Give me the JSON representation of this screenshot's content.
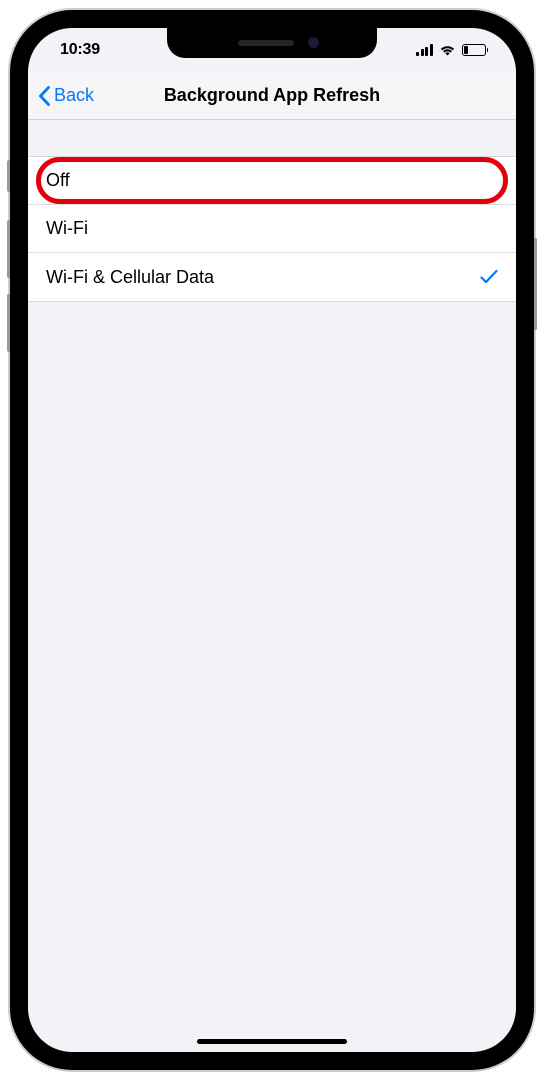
{
  "status": {
    "time": "10:39"
  },
  "nav": {
    "back_label": "Back",
    "title": "Background App Refresh"
  },
  "options": {
    "items": [
      {
        "label": "Off",
        "selected": false,
        "highlighted": true
      },
      {
        "label": "Wi-Fi",
        "selected": false,
        "highlighted": false
      },
      {
        "label": "Wi-Fi & Cellular Data",
        "selected": true,
        "highlighted": false
      }
    ]
  }
}
